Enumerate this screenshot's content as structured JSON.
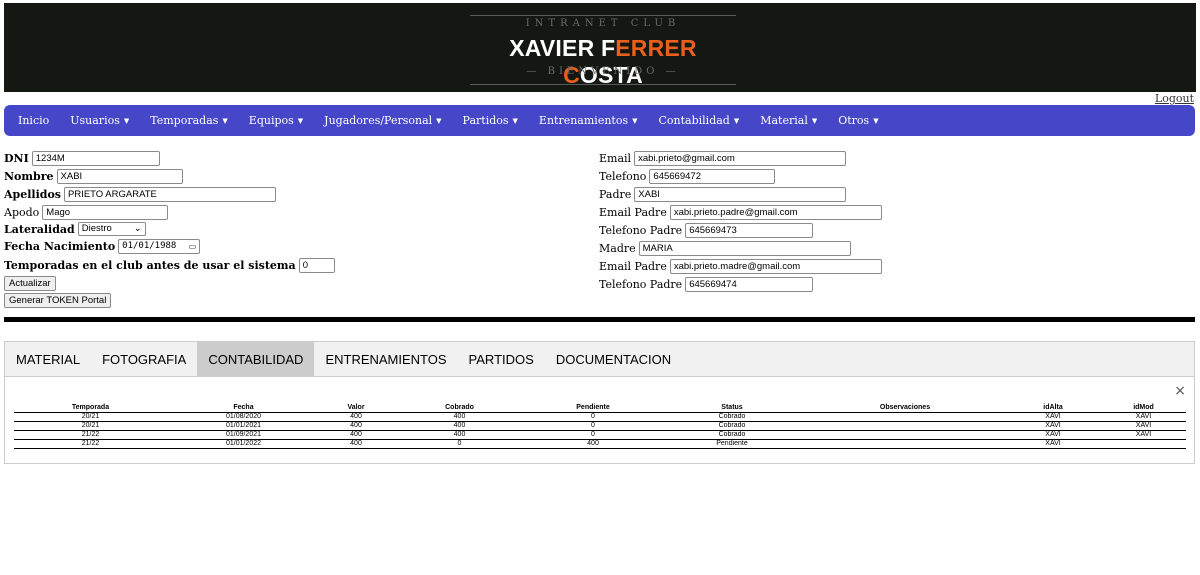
{
  "header": {
    "logo_top": "INTRANET CLUB",
    "logo_main_parts": [
      "XAVIER F",
      "ERRER",
      " ",
      "C",
      "OSTA"
    ],
    "logo_bottom": "— BIENVENIDO —",
    "accent_color": "#e8601c"
  },
  "logout": "Logout",
  "nav": {
    "items": [
      "Inicio",
      "Usuarios",
      "Temporadas",
      "Equipos",
      "Jugadores/Personal",
      "Partidos",
      "Entrenamientos",
      "Contabilidad",
      "Material",
      "Otros"
    ],
    "caret": "▼",
    "bg_color": "#4646c8"
  },
  "form_left": {
    "dni_label": "DNI",
    "dni_value": "1234M",
    "nombre_label": "Nombre",
    "nombre_value": "XABI",
    "apellidos_label": "Apellidos",
    "apellidos_value": "PRIETO ARGARATE",
    "apodo_label": "Apodo",
    "apodo_value": "Mago",
    "lateralidad_label": "Lateralidad",
    "lateralidad_value": "Diestro",
    "fecha_label": "Fecha Nacimiento",
    "fecha_value": "01/01/1988",
    "temporadas_label": "Temporadas en el club antes de usar el sistema",
    "temporadas_value": "0",
    "actualizar_btn": "Actualizar",
    "token_btn": "Generar TOKEN Portal"
  },
  "form_right": {
    "email_label": "Email",
    "email_value": "xabi.prieto@gmail.com",
    "telefono_label": "Telefono",
    "telefono_value": "645669472",
    "padre_label": "Padre",
    "padre_value": "XABI",
    "email_padre_label": "Email Padre",
    "email_padre_value": "xabi.prieto.padre@gmail.com",
    "telefono_padre_label": "Telefono Padre",
    "telefono_padre_value": "645669473",
    "madre_label": "Madre",
    "madre_value": "MARIA",
    "email_madre_label": "Email Padre",
    "email_madre_value": "xabi.prieto.madre@gmail.com",
    "telefono_madre_label": "Telefono Padre",
    "telefono_madre_value": "645669474"
  },
  "tabs": {
    "items": [
      "MATERIAL",
      "FOTOGRAFIA",
      "CONTABILIDAD",
      "ENTRENAMIENTOS",
      "PARTIDOS",
      "DOCUMENTACION"
    ],
    "active": "CONTABILIDAD",
    "close": "×"
  },
  "table": {
    "headers": [
      "Temporada",
      "Fecha",
      "Valor",
      "Cobrado",
      "Pendiente",
      "Status",
      "Observaciones",
      "idAlta",
      "idMod"
    ],
    "rows": [
      [
        "20/21",
        "01/08/2020",
        "400",
        "400",
        "0",
        "Cobrado",
        "",
        "XAVI",
        "XAVI"
      ],
      [
        "20/21",
        "01/01/2021",
        "400",
        "400",
        "0",
        "Cobrado",
        "",
        "XAVI",
        "XAVI"
      ],
      [
        "21/22",
        "01/09/2021",
        "400",
        "400",
        "0",
        "Cobrado",
        "",
        "XAVI",
        "XAVI"
      ],
      [
        "21/22",
        "01/01/2022",
        "400",
        "0",
        "400",
        "Pendiente",
        "",
        "XAVI",
        ""
      ]
    ]
  }
}
